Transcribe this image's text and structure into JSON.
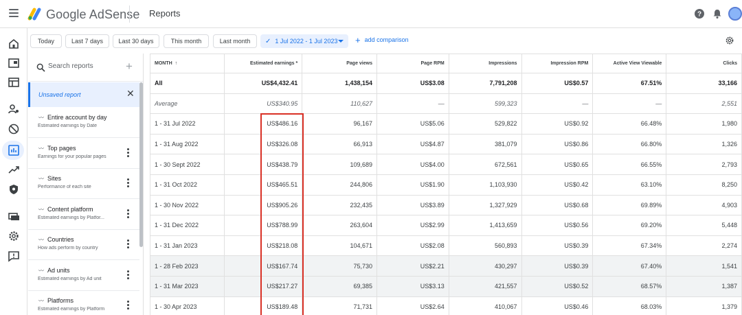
{
  "app": {
    "name": "Google AdSense",
    "page_title": "Reports"
  },
  "toolbar": {
    "chips": [
      "Today",
      "Last 7 days",
      "Last 30 days",
      "This month",
      "Last month"
    ],
    "date_range": "1 Jul 2022 - 1 Jul 2023",
    "add_comparison": "add comparison"
  },
  "panel": {
    "search_placeholder": "Search reports",
    "unsaved_report": "Unsaved report",
    "reports": [
      {
        "title": "Entire account by day",
        "subtitle": "Estimated earnings by Date"
      },
      {
        "title": "Top pages",
        "subtitle": "Earnings for your popular pages"
      },
      {
        "title": "Sites",
        "subtitle": "Performance of each site"
      },
      {
        "title": "Content platform",
        "subtitle": "Estimated earnings by Platfor..."
      },
      {
        "title": "Countries",
        "subtitle": "How ads perform by country"
      },
      {
        "title": "Ad units",
        "subtitle": "Estimated earnings by Ad unit"
      },
      {
        "title": "Platforms",
        "subtitle": "Estimated earnings by Platform"
      }
    ]
  },
  "table": {
    "columns": [
      "MONTH",
      "Estimated earnings *",
      "Page views",
      "Page RPM",
      "Impressions",
      "Impression RPM",
      "Active View Viewable",
      "Clicks"
    ],
    "total": [
      "All",
      "US$4,432.41",
      "1,438,154",
      "US$3.08",
      "7,791,208",
      "US$0.57",
      "67.51%",
      "33,166"
    ],
    "average": [
      "Average",
      "US$340.95",
      "110,627",
      "—",
      "599,323",
      "—",
      "—",
      "2,551"
    ],
    "rows": [
      [
        "1 - 31 Jul 2022",
        "US$486.16",
        "96,167",
        "US$5.06",
        "529,822",
        "US$0.92",
        "66.48%",
        "1,980"
      ],
      [
        "1 - 31 Aug 2022",
        "US$326.08",
        "66,913",
        "US$4.87",
        "381,079",
        "US$0.86",
        "66.80%",
        "1,326"
      ],
      [
        "1 - 30 Sept 2022",
        "US$438.79",
        "109,689",
        "US$4.00",
        "672,561",
        "US$0.65",
        "66.55%",
        "2,793"
      ],
      [
        "1 - 31 Oct 2022",
        "US$465.51",
        "244,806",
        "US$1.90",
        "1,103,930",
        "US$0.42",
        "63.10%",
        "8,250"
      ],
      [
        "1 - 30 Nov 2022",
        "US$905.26",
        "232,435",
        "US$3.89",
        "1,327,929",
        "US$0.68",
        "69.89%",
        "4,903"
      ],
      [
        "1 - 31 Dec 2022",
        "US$788.99",
        "263,604",
        "US$2.99",
        "1,413,659",
        "US$0.56",
        "69.20%",
        "5,448"
      ],
      [
        "1 - 31 Jan 2023",
        "US$218.08",
        "104,671",
        "US$2.08",
        "560,893",
        "US$0.39",
        "67.34%",
        "2,274"
      ],
      [
        "1 - 28 Feb 2023",
        "US$167.74",
        "75,730",
        "US$2.21",
        "430,297",
        "US$0.39",
        "67.40%",
        "1,541"
      ],
      [
        "1 - 31 Mar 2023",
        "US$217.27",
        "69,385",
        "US$3.13",
        "421,557",
        "US$0.52",
        "68.57%",
        "1,387"
      ],
      [
        "1 - 30 Apr 2023",
        "US$189.48",
        "71,731",
        "US$2.64",
        "410,067",
        "US$0.46",
        "68.03%",
        "1,379"
      ]
    ]
  },
  "colors": {
    "accent": "#1a73e8",
    "highlight": "#d93025",
    "selected_bg": "#e8f0fe"
  }
}
